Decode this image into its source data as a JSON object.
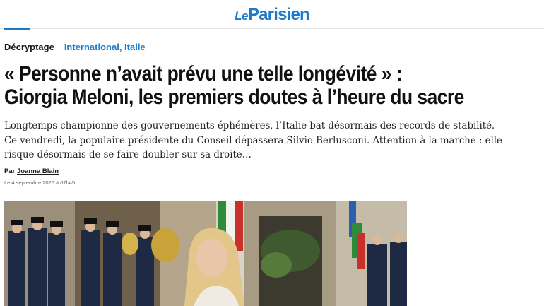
{
  "header": {
    "logo_prefix": "Le",
    "logo_brand": "Parisien"
  },
  "article": {
    "kind": "Décryptage",
    "section": "International, Italie",
    "headline": "« Personne n’avait prévu une telle longévité » : Giorgia Meloni, les premiers doutes à l’heure du sacre",
    "lead": "Longtemps championne des gouvernements éphémères, l’Italie bat désormais des records de stabilité. Ce vendredi, la populaire présidente du Conseil dépassera Silvio Berlusconi. Attention à la marche : elle risque désormais de se faire doubler sur sa droite…",
    "by_prefix": "Par",
    "author": "Joanna Blain",
    "date": "Le 4 septembre 2026 à 07h45"
  },
  "colors": {
    "brand_blue": "#1d7ac9",
    "text": "#111111"
  },
  "image": {
    "subject": "Giorgia Meloni in front of an honor guard and military band"
  }
}
